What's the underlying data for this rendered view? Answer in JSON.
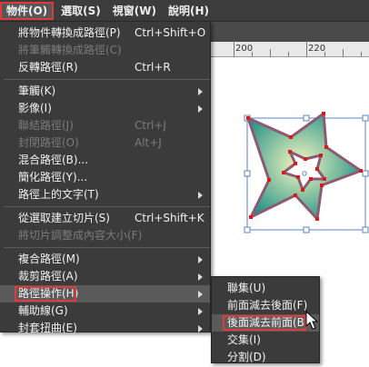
{
  "menubar": {
    "items": [
      {
        "label": "物件(O)",
        "active": true
      },
      {
        "label": "選取(S)"
      },
      {
        "label": "視窗(W)"
      },
      {
        "label": "說明(H)"
      }
    ]
  },
  "ruler": {
    "labels": [
      "200",
      "220"
    ]
  },
  "menu": {
    "groups": [
      [
        {
          "label": "將物件轉換成路徑(P)",
          "shortcut": "Ctrl+Shift+O"
        },
        {
          "label": "將筆觸轉換成路徑(C)",
          "disabled": true
        },
        {
          "label": "反轉路徑(R)",
          "shortcut": "Ctrl+R"
        }
      ],
      [
        {
          "label": "筆觸(K)",
          "submenu": true
        },
        {
          "label": "影像(I)",
          "submenu": true
        },
        {
          "label": "聯結路徑(J)",
          "shortcut": "Ctrl+J",
          "disabled": true
        },
        {
          "label": "封閉路徑(O)",
          "shortcut": "Alt+J",
          "disabled": true
        },
        {
          "label": "混合路徑(B)..."
        },
        {
          "label": "簡化路徑(Y)..."
        },
        {
          "label": "路徑上的文字(T)",
          "submenu": true
        }
      ],
      [
        {
          "label": "從選取建立切片(S)",
          "shortcut": "Ctrl+Shift+K"
        },
        {
          "label": "將切片調整成內容大小(F)",
          "disabled": true
        }
      ],
      [
        {
          "label": "複合路徑(M)",
          "submenu": true
        },
        {
          "label": "裁剪路徑(A)",
          "submenu": true
        },
        {
          "label": "路徑操作(H)",
          "submenu": true,
          "highlight": true
        },
        {
          "label": "輔助線(G)",
          "submenu": true
        },
        {
          "label": "封套扭曲(E)",
          "submenu": true
        }
      ]
    ]
  },
  "submenu": {
    "items": [
      {
        "label": "聯集(U)"
      },
      {
        "label": "前面減去後面(F)"
      },
      {
        "label": "後面減去前面(B)",
        "selected": true
      },
      {
        "label": "交集(I)"
      },
      {
        "label": "分割(D)"
      }
    ]
  },
  "colors": {
    "highlight_border": "#e23a3a",
    "star_fill_center": "#f4f7c0",
    "star_fill_edge": "#1f8f86",
    "star_stroke": "#8c5a72",
    "anchor": "#e01818",
    "selection_box": "#5a86c9"
  }
}
